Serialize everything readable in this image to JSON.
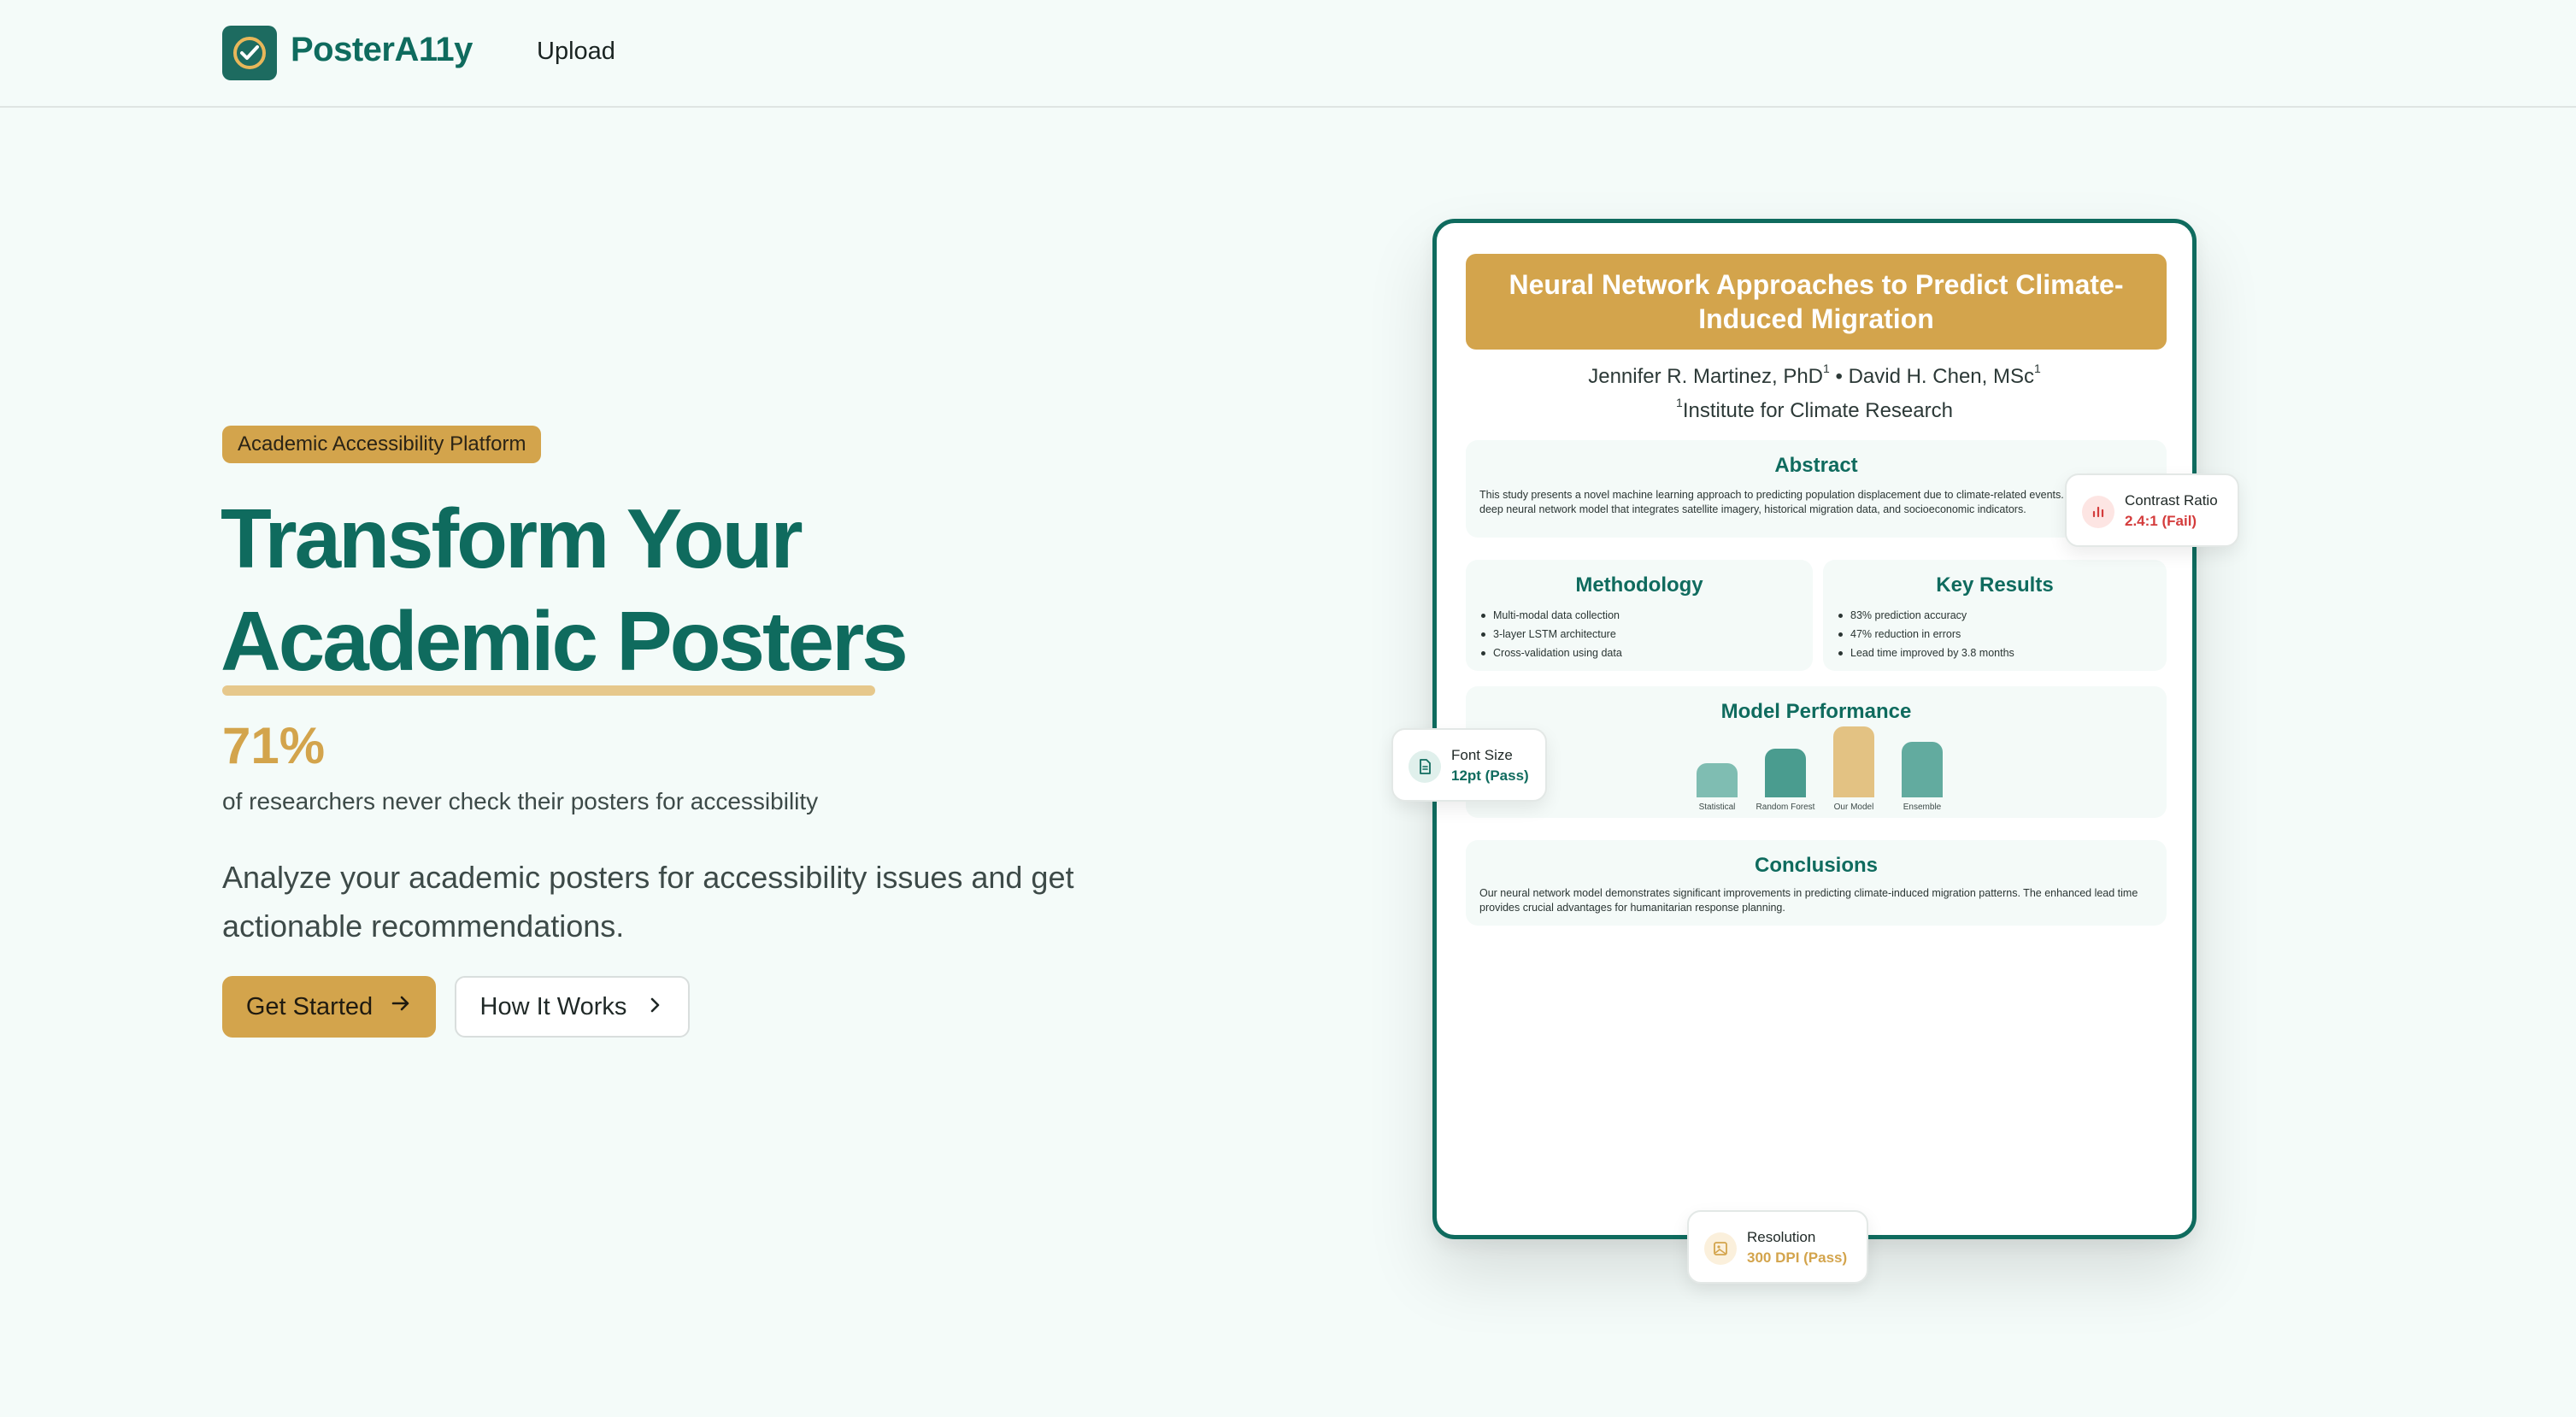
{
  "nav": {
    "brand": "PosterA11y",
    "upload": "Upload"
  },
  "hero": {
    "badge": "Academic Accessibility Platform",
    "title_line1": "Transform Your",
    "title_line2": "Academic Posters",
    "stat_value": "71%",
    "stat_text": "of researchers never check their posters for accessibility",
    "lead": "Analyze your academic posters for accessibility issues and get actionable recommendations.",
    "primary_button": "Get Started",
    "secondary_button": "How It Works"
  },
  "poster": {
    "title": "Neural Network Approaches to Predict Climate-Induced Migration",
    "author1": "Jennifer R. Martinez, PhD",
    "author2": "David H. Chen, MSc",
    "sup": "1",
    "separator": "•",
    "institution": "Institute for Climate Research",
    "abstract": {
      "heading": "Abstract",
      "body": "This study presents a novel machine learning approach to predicting population displacement due to climate-related events. We developed a deep neural network model that integrates satellite imagery, historical migration data, and socioeconomic indicators."
    },
    "methodology": {
      "heading": "Methodology",
      "items": [
        "Multi-modal data collection",
        "3-layer LSTM architecture",
        "Cross-validation using data"
      ]
    },
    "results": {
      "heading": "Key Results",
      "items": [
        "83% prediction accuracy",
        "47% reduction in errors",
        "Lead time improved by 3.8 months"
      ]
    },
    "performance": {
      "heading": "Model Performance"
    },
    "conclusions": {
      "heading": "Conclusions",
      "body": "Our neural network model demonstrates significant improvements in predicting climate-induced migration patterns. The enhanced lead time provides crucial advantages for humanitarian response planning."
    }
  },
  "chart_data": {
    "type": "bar",
    "categories": [
      "Statistical",
      "Random Forest",
      "Our Model",
      "Ensemble"
    ],
    "values": [
      0.45,
      0.63,
      0.92,
      0.72
    ],
    "colors": [
      "#7fbdb2",
      "#4a9c8f",
      "#e3c283",
      "#62ab9f"
    ]
  },
  "checks": {
    "contrast": {
      "title": "Contrast Ratio",
      "value": "2.4:1 (Fail)",
      "color": "#d43c3c",
      "icon": "bar-chart-icon"
    },
    "font": {
      "title": "Font Size",
      "value": "12pt (Pass)",
      "color": "#0f6b5e",
      "icon": "document-icon"
    },
    "resolution": {
      "title": "Resolution",
      "value": "300 DPI (Pass)",
      "color": "#d3a44c",
      "icon": "image-icon"
    }
  },
  "colors": {
    "primary": "#0f6b5e",
    "accent": "#d3a44c",
    "background": "#f4fbf9"
  }
}
